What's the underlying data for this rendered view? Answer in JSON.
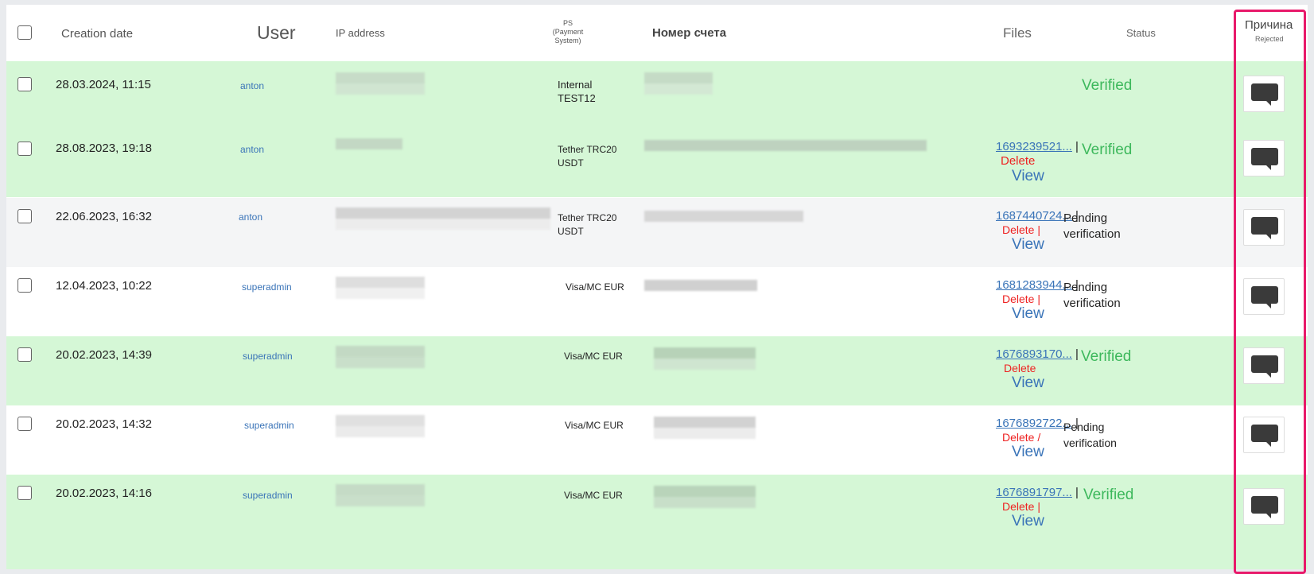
{
  "header": {
    "creation_date": "Creation date",
    "user": "User",
    "ip_address": "IP address",
    "ps_line1": "PS",
    "ps_line2": "(Payment",
    "ps_line3": "System)",
    "account_number": "Номер счета",
    "files": "Files",
    "status": "Status",
    "reason": "Причина",
    "rejected": "Rejected"
  },
  "rows": [
    {
      "date": "28.03.2024, 11:15",
      "user": "anton",
      "ps1": "Internal",
      "ps2": "TEST12",
      "file_id": "",
      "pipe": "",
      "delete": "",
      "view": "",
      "status1": "Verified",
      "status2": ""
    },
    {
      "date": "28.08.2023, 19:18",
      "user": "anton",
      "ps1": "Tether TRC20",
      "ps2": "USDT",
      "file_id": "1693239521...",
      "pipe": "|",
      "delete": "Delete",
      "view": "View",
      "status1": "Verified",
      "status2": ""
    },
    {
      "date": "22.06.2023, 16:32",
      "user": "anton",
      "ps1": "Tether TRC20",
      "ps2": "USDT",
      "file_id": "1687440724...",
      "pipe": "|",
      "delete": "Delete |",
      "view": "View",
      "status1": "Pending",
      "status2": "verification"
    },
    {
      "date": "12.04.2023, 10:22",
      "user": "superadmin",
      "ps1": "Visa/MC EUR",
      "ps2": "",
      "file_id": "1681283944...",
      "pipe": "|",
      "delete": "Delete |",
      "view": "View",
      "status1": "Pending",
      "status2": "verification"
    },
    {
      "date": "20.02.2023, 14:39",
      "user": "superadmin",
      "ps1": "Visa/MC EUR",
      "ps2": "",
      "file_id": "1676893170...",
      "pipe": "|",
      "delete": "Delete",
      "view": "View",
      "status1": "Verified",
      "status2": ""
    },
    {
      "date": "20.02.2023, 14:32",
      "user": "superadmin",
      "ps1": "Visa/MC EUR",
      "ps2": "",
      "file_id": "1676892722...",
      "pipe": "|",
      "delete": "Delete /",
      "view": "View",
      "status1": "Pending",
      "status2": "verification"
    },
    {
      "date": "20.02.2023, 14:16",
      "user": "superadmin",
      "ps1": "Visa/MC EUR",
      "ps2": "",
      "file_id": "1676891797...",
      "pipe": "|",
      "delete": "Delete |",
      "view": "View",
      "status1": "Verified",
      "status2": ""
    }
  ],
  "colors": {
    "verified": "#3db85c",
    "link": "#3a74b8",
    "delete": "#e22",
    "highlight": "#e8196a",
    "row_green": "#d5f7d6"
  }
}
